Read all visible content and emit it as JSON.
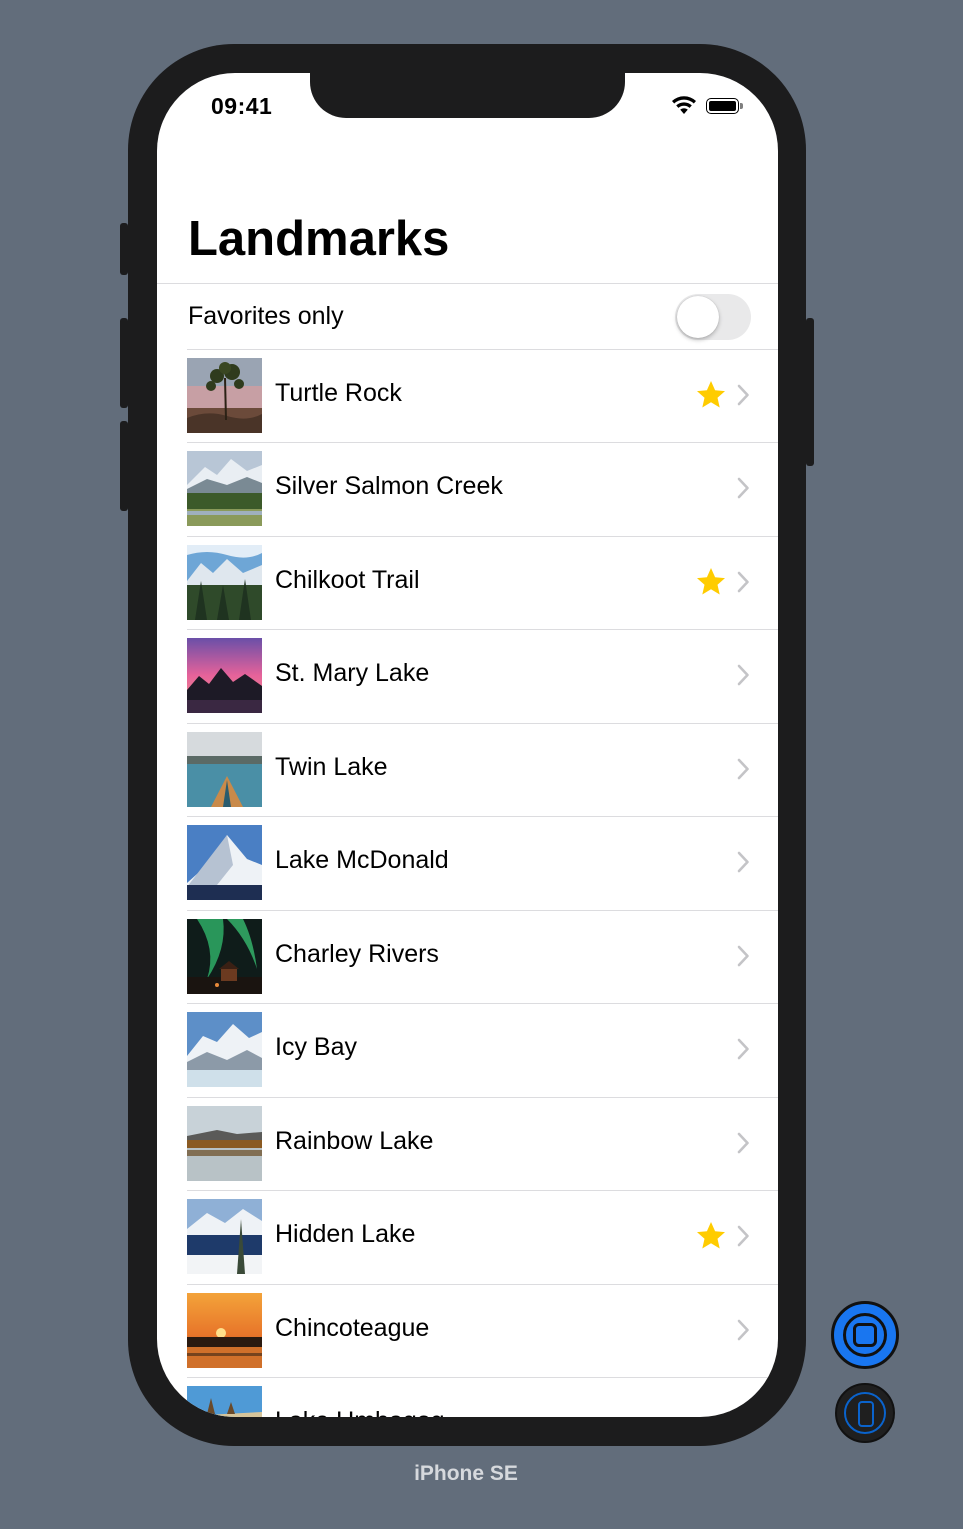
{
  "status_bar": {
    "time": "09:41"
  },
  "navigation": {
    "title": "Landmarks"
  },
  "filter": {
    "label": "Favorites only",
    "enabled": false
  },
  "landmarks": [
    {
      "name": "Turtle Rock",
      "favorite": true,
      "thumbnail": "turtlerock"
    },
    {
      "name": "Silver Salmon Creek",
      "favorite": false,
      "thumbnail": "silversalmoncreek"
    },
    {
      "name": "Chilkoot Trail",
      "favorite": true,
      "thumbnail": "chilkoottrail"
    },
    {
      "name": "St. Mary Lake",
      "favorite": false,
      "thumbnail": "stmarylake"
    },
    {
      "name": "Twin Lake",
      "favorite": false,
      "thumbnail": "twinlake"
    },
    {
      "name": "Lake McDonald",
      "favorite": false,
      "thumbnail": "lakemcdonald"
    },
    {
      "name": "Charley Rivers",
      "favorite": false,
      "thumbnail": "charleyrivers"
    },
    {
      "name": "Icy Bay",
      "favorite": false,
      "thumbnail": "icybay"
    },
    {
      "name": "Rainbow Lake",
      "favorite": false,
      "thumbnail": "rainbowlake"
    },
    {
      "name": "Hidden Lake",
      "favorite": true,
      "thumbnail": "hiddenlake"
    },
    {
      "name": "Chincoteague",
      "favorite": false,
      "thumbnail": "chincoteague"
    },
    {
      "name": "Lake Umbagog",
      "favorite": false,
      "thumbnail": "umbagog"
    }
  ],
  "simulator": {
    "device_name": "iPhone SE"
  },
  "colors": {
    "favorite_star": "#ffcc00",
    "chevron": "#c4c4c7",
    "background": "#626d7b"
  }
}
